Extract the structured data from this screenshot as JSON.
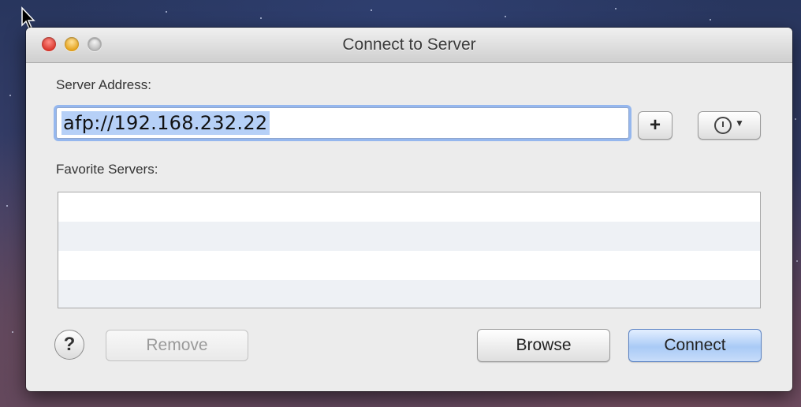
{
  "window": {
    "title": "Connect to Server"
  },
  "form": {
    "server_address_label": "Server Address:",
    "server_address_value": "afp://192.168.232.22",
    "add_favorite_label": "+",
    "favorites_label": "Favorite Servers:"
  },
  "favorites": {
    "rows": [
      "",
      "",
      "",
      ""
    ]
  },
  "buttons": {
    "help": "?",
    "remove": "Remove",
    "browse": "Browse",
    "connect": "Connect"
  },
  "icons": {
    "recent_servers": "clock-icon",
    "dropdown": "triangle-down-icon"
  }
}
